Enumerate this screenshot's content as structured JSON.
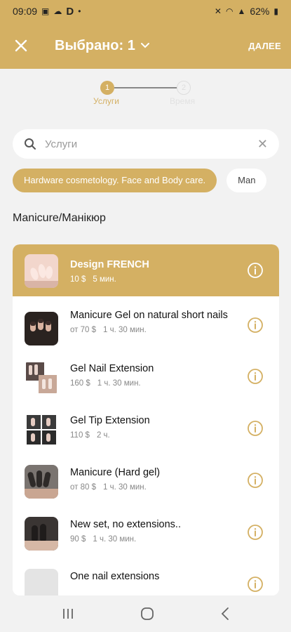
{
  "status_bar": {
    "time": "09:09",
    "icons_left": [
      "photo-icon",
      "cloud-icon",
      "d-app-icon",
      "dot-icon"
    ],
    "battery": "62%",
    "icons_right": [
      "mute-icon",
      "wifi-icon",
      "signal-icon",
      "battery-icon"
    ]
  },
  "app_bar": {
    "title": "Выбрано: 1",
    "next_label": "ДАЛЕЕ"
  },
  "stepper": {
    "steps": [
      {
        "num": "1",
        "label": "Услуги"
      },
      {
        "num": "2",
        "label": "Время"
      }
    ]
  },
  "search": {
    "placeholder": "Услуги"
  },
  "chips": [
    "Hardware cosmetology. Face and Body care.",
    "Man"
  ],
  "section_title": "Manicure/Манікюр",
  "services": [
    {
      "name": "Design FRENCH",
      "price": "10 $",
      "duration": "5 мин."
    },
    {
      "name": "Manicure Gel on natural short nails",
      "price": "от 70 $",
      "duration": "1 ч. 30 мин."
    },
    {
      "name": "Gel Nail  Extension",
      "price": "160 $",
      "duration": "1 ч. 30 мин."
    },
    {
      "name": "Gel Tip Extension",
      "price": "110 $",
      "duration": "2 ч."
    },
    {
      "name": "Manicure (Hard gel)",
      "price": "от 80 $",
      "duration": "1 ч. 30 мин."
    },
    {
      "name": "New set, no extensions..",
      "price": "90 $",
      "duration": "1 ч. 30 мин."
    },
    {
      "name": "One nail extensions",
      "price": "",
      "duration": ""
    }
  ],
  "colors": {
    "accent": "#d4b063",
    "background": "#f2f2f2"
  }
}
